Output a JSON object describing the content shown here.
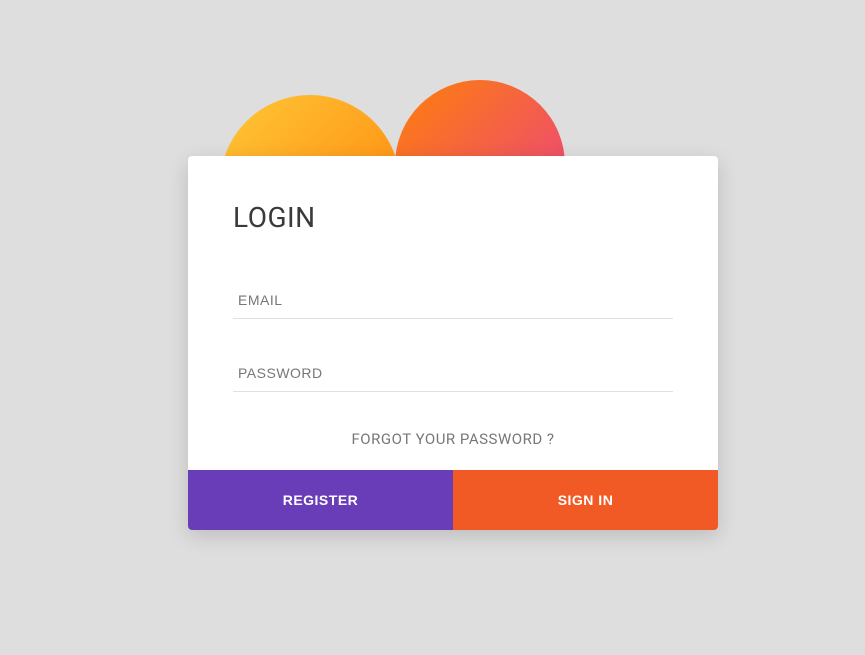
{
  "card": {
    "title": "LOGIN",
    "email_placeholder": "EMAIL",
    "password_placeholder": "PASSWORD",
    "forgot_label": "FORGOT YOUR PASSWORD ?",
    "register_label": "REGISTER",
    "signin_label": "SIGN IN"
  }
}
